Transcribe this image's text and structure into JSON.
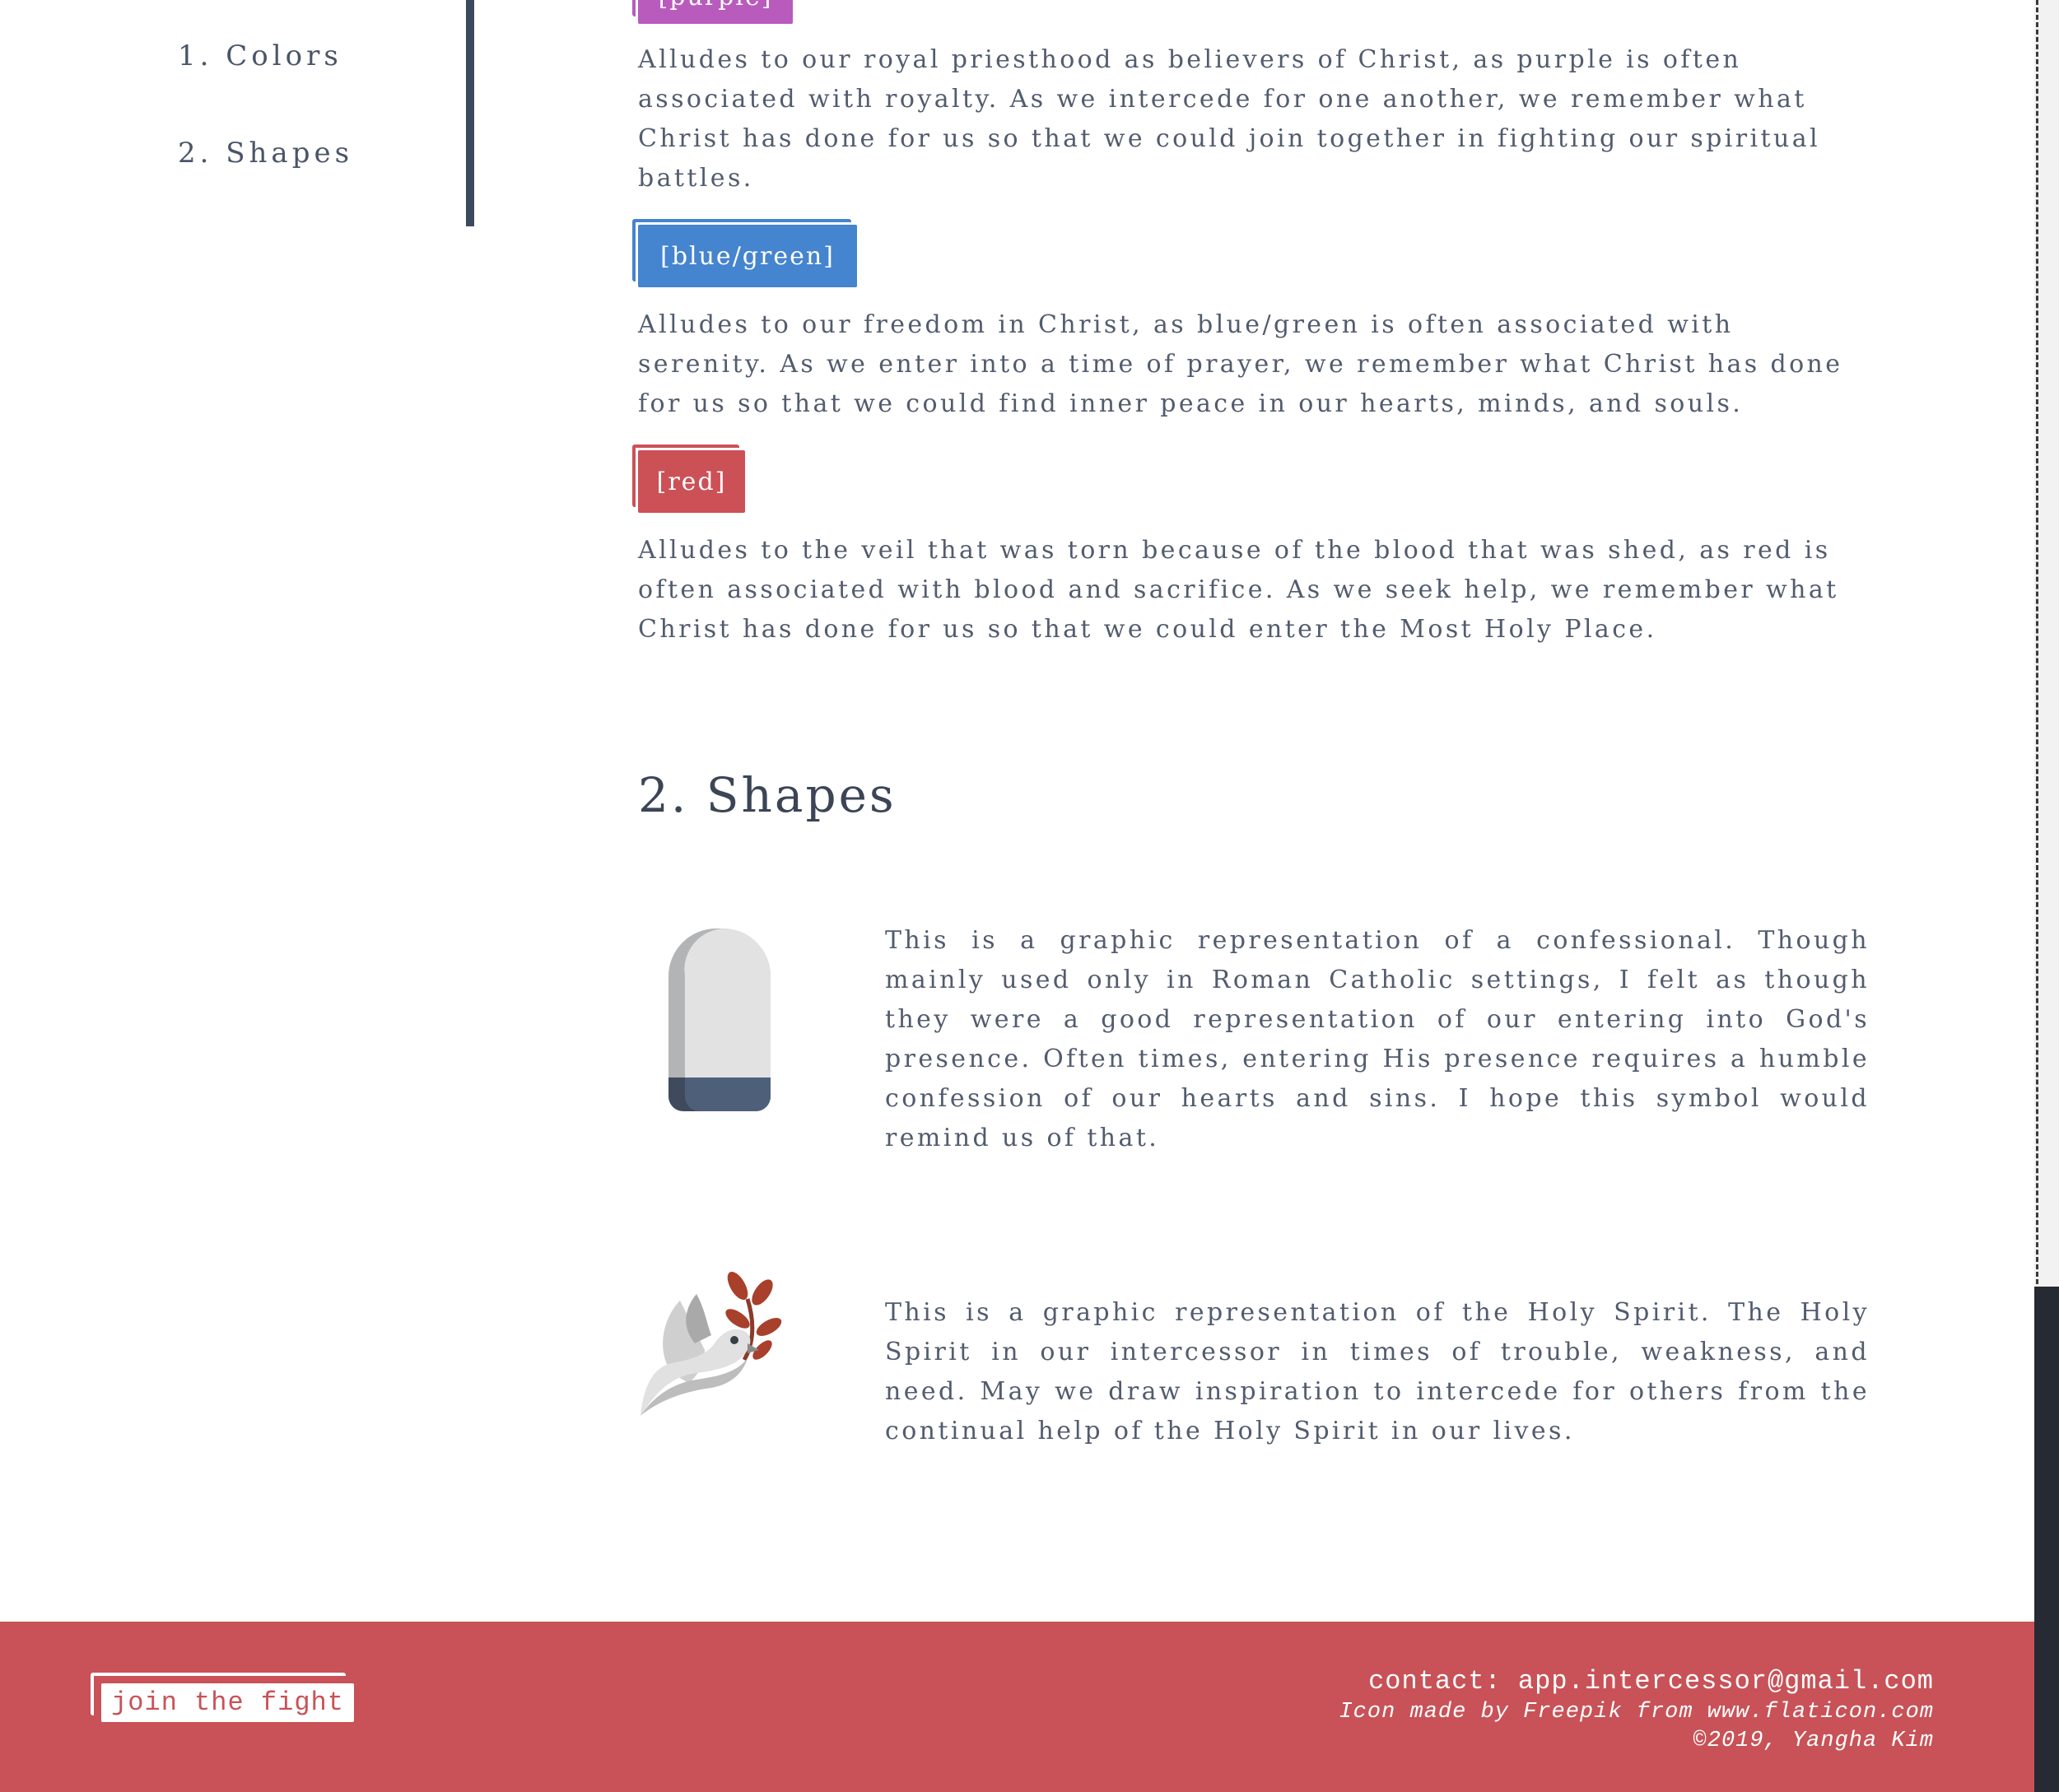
{
  "sidebar": {
    "items": [
      {
        "label": "1. Colors"
      },
      {
        "label": "2. Shapes"
      }
    ]
  },
  "colors": {
    "purple": {
      "tag": "[purple]",
      "color": "#b95bbd",
      "text": "Alludes to our royal priesthood as believers of Christ, as purple is often associated with royalty. As we intercede for one another, we remember what Christ has done for us so that we could join together in fighting our spiritual battles."
    },
    "blue_green": {
      "tag": "[blue/green]",
      "color": "#4584cf",
      "text": "Alludes to our freedom in Christ, as blue/green is often associated with serenity. As we enter into a time of prayer, we remember what Christ has done for us so that we could find inner peace in our hearts, minds, and souls."
    },
    "red": {
      "tag": "[red]",
      "color": "#cc5157",
      "text": "Alludes to the veil that was torn because of the blood that was shed, as red is often associated with blood and sacrifice. As we seek help, we remember what Christ has done for us so that we could enter the Most Holy Place."
    }
  },
  "shapes": {
    "heading": "2. Shapes",
    "items": [
      {
        "icon": "confessional-icon",
        "text": "This is a graphic representation of a confessional. Though mainly used only in Roman Catholic settings, I felt as though they were a good representation of our entering into God's presence. Often times, entering His presence requires a humble confession of our hearts and sins. I hope this symbol would remind us of that."
      },
      {
        "icon": "dove-icon",
        "text": "This is a graphic representation of the Holy Spirit. The Holy Spirit in our intercessor in times of trouble, weakness, and need. May we draw inspiration to intercede for others from the continual help of the Holy Spirit in our lives."
      }
    ]
  },
  "footer": {
    "button_label": "join the fight",
    "contact": "contact: app.intercessor@gmail.com",
    "credit": "Icon made by Freepik from www.flaticon.com",
    "copyright": "©2019, Yangha Kim",
    "background": "#c85257"
  }
}
